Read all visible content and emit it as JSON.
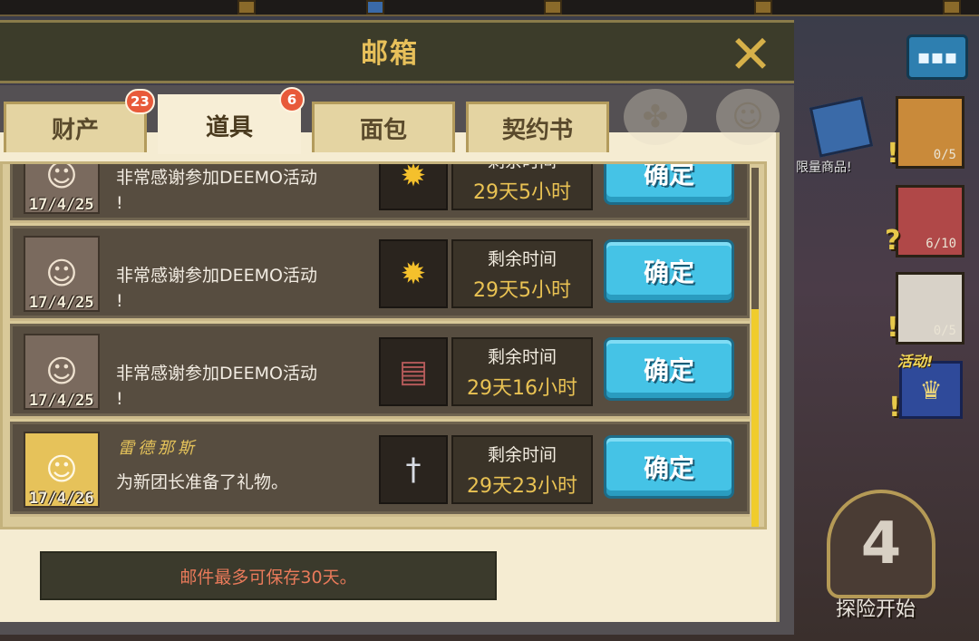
{
  "dialog": {
    "title": "邮箱",
    "close_symbol": "✕"
  },
  "tabs": [
    {
      "label": "财产",
      "badge": "23"
    },
    {
      "label": "道具",
      "badge": "6",
      "active": true
    },
    {
      "label": "面包"
    },
    {
      "label": "契约书"
    }
  ],
  "mails": [
    {
      "sender": "",
      "message_line1": "非常感谢参加DEEMO活动",
      "message_line2": "!",
      "date": "17/4/25",
      "item_icon": "coin-bag-icon",
      "time_label": "剩余时间",
      "time_value": "29天5小时",
      "button": "确定"
    },
    {
      "sender": "",
      "message_line1": "非常感谢参加DEEMO活动",
      "message_line2": "!",
      "date": "17/4/25",
      "item_icon": "coin-bag-icon",
      "time_label": "剩余时间",
      "time_value": "29天5小时",
      "button": "确定"
    },
    {
      "sender": "",
      "message_line1": "非常感谢参加DEEMO活动",
      "message_line2": "!",
      "date": "17/4/25",
      "item_icon": "cabinet-icon",
      "time_label": "剩余时间",
      "time_value": "29天16小时",
      "button": "确定"
    },
    {
      "sender": "雷德那斯",
      "message_line1": "为新团长准备了礼物。",
      "message_line2": "",
      "date": "17/4/26",
      "item_icon": "sword-icon",
      "time_label": "剩余时间",
      "time_value": "29天23小时",
      "button": "确定"
    }
  ],
  "notice": "邮件最多可保存30天。",
  "side": {
    "limited_label": "限量商品!",
    "counts": [
      "0/5",
      "6/10",
      "0/5"
    ],
    "event_label": "活动!",
    "explore_label": "探险开始"
  },
  "colors": {
    "title_gold": "#e7c05a",
    "button_blue": "#45c3e6",
    "notice_red": "#e97a5a",
    "badge_red": "#e85a3a",
    "scroll_yellow": "#f0cc2c"
  }
}
